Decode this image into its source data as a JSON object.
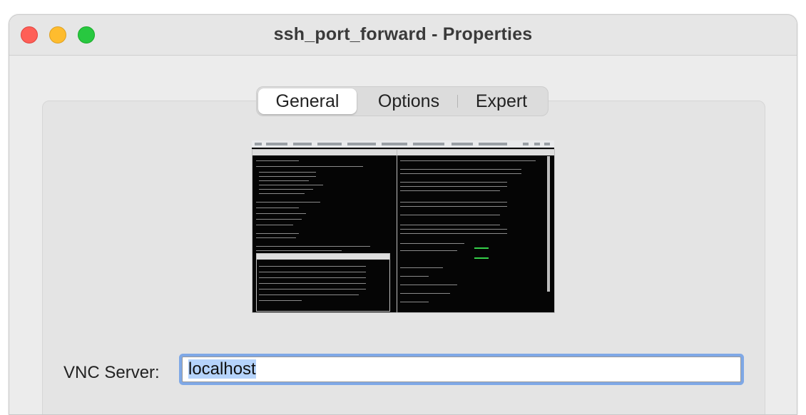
{
  "window": {
    "title": "ssh_port_forward - Properties"
  },
  "traffic_lights": {
    "close_color": "#ff5f57",
    "minimize_color": "#febc2e",
    "maximize_color": "#28c840"
  },
  "tabs": [
    {
      "label": "General",
      "selected": true
    },
    {
      "label": "Options",
      "selected": false
    },
    {
      "label": "Expert",
      "selected": false
    }
  ],
  "preview": {
    "description_icon": "screen-thumbnail"
  },
  "vnc_server": {
    "label": "VNC Server:",
    "value": "localhost",
    "selected": true
  },
  "colors": {
    "focus_ring": "#7fa8e6",
    "selection": "#b5d3fb"
  }
}
